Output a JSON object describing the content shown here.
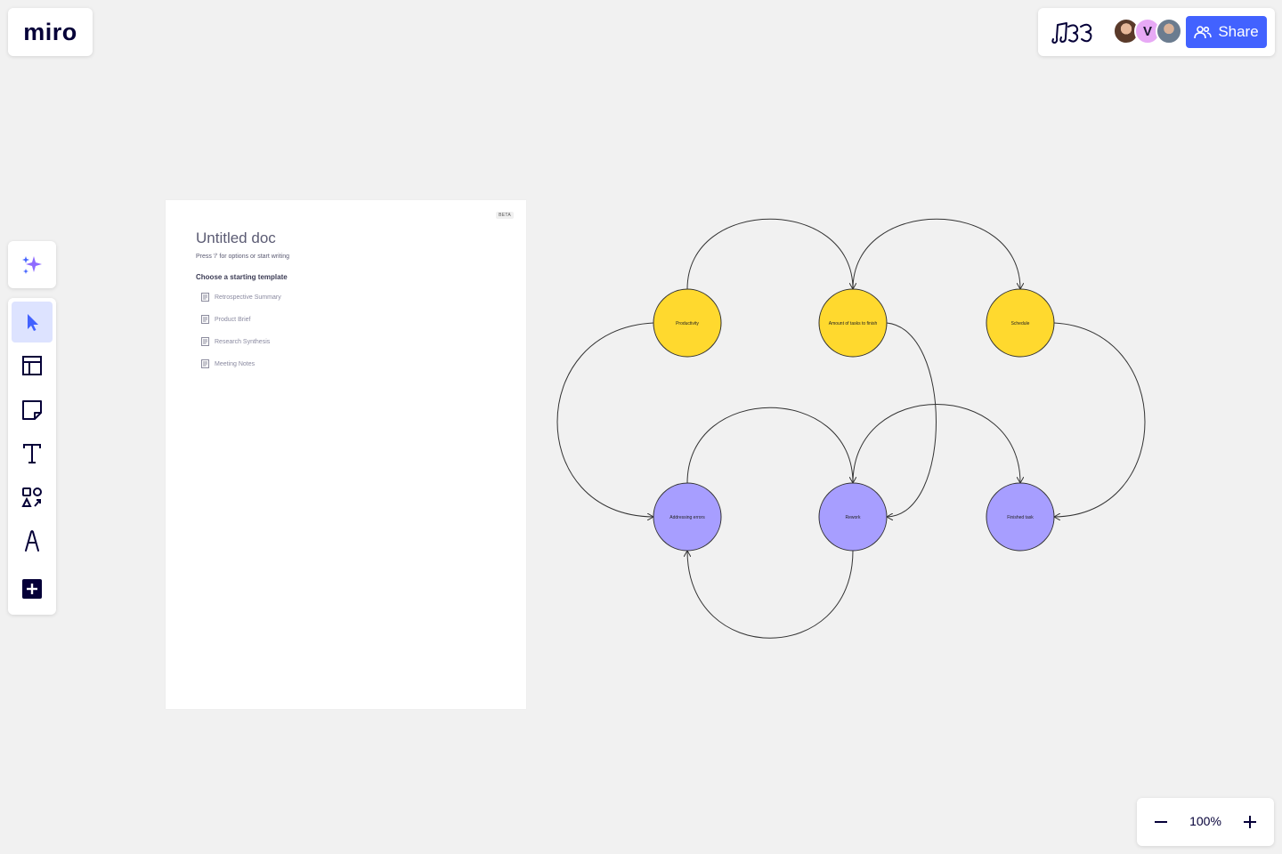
{
  "app": {
    "logo": "miro"
  },
  "header": {
    "share_label": "Share",
    "collaborators": [
      {
        "name": "user-photo-1"
      },
      {
        "initial": "V",
        "color": "#e7a9f5"
      },
      {
        "name": "user-photo-2"
      }
    ],
    "accent_color": "#4262ff"
  },
  "toolbar": {
    "items": [
      {
        "name": "select",
        "icon": "cursor-icon",
        "active": true
      },
      {
        "name": "templates",
        "icon": "templates-icon"
      },
      {
        "name": "sticky-note",
        "icon": "sticky-note-icon"
      },
      {
        "name": "text",
        "icon": "text-icon"
      },
      {
        "name": "shapes",
        "icon": "shapes-icon"
      },
      {
        "name": "pen",
        "icon": "pen-icon"
      },
      {
        "name": "more",
        "icon": "plus-icon"
      }
    ]
  },
  "doc": {
    "badge": "BETA",
    "title": "Untitled doc",
    "subtitle": "Press '/' for options or start writing",
    "section_label": "Choose a starting template",
    "templates": [
      "Retrospective Summary",
      "Product Brief",
      "Research Synthesis",
      "Meeting Notes"
    ]
  },
  "diagram": {
    "nodes": [
      {
        "id": "productivity",
        "label": "Productivity",
        "color": "#ffd92e"
      },
      {
        "id": "tasks",
        "label": "Amount of tasks to finish",
        "color": "#ffd92e"
      },
      {
        "id": "schedule",
        "label": "Schedule",
        "color": "#ffd92e"
      },
      {
        "id": "errors",
        "label": "Addressing errors",
        "color": "#a79eff"
      },
      {
        "id": "rework",
        "label": "Rework",
        "color": "#a79eff"
      },
      {
        "id": "finished",
        "label": "Finished task",
        "color": "#a79eff"
      }
    ]
  },
  "zoom": {
    "value": "100%"
  }
}
